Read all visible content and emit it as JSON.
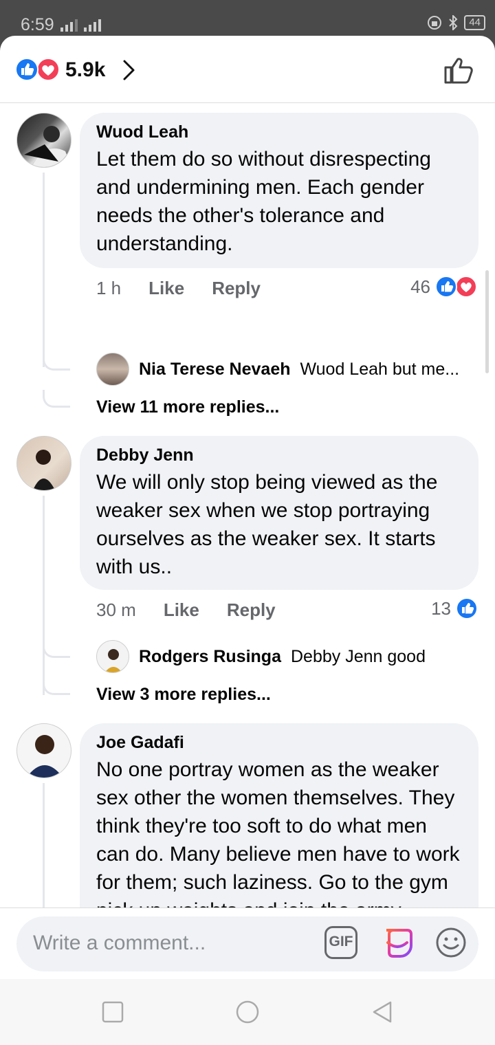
{
  "status_bar": {
    "time": "6:59",
    "battery": "44"
  },
  "header": {
    "reaction_count": "5.9k"
  },
  "comments": [
    {
      "author": "Wuod Leah",
      "text": "Let them do so without disrespecting and undermining men. Each gender needs the other's tolerance and understanding.",
      "time": "1 h",
      "like_label": "Like",
      "reply_label": "Reply",
      "reactions": "46",
      "reply_preview": {
        "author": "Nia Terese Nevaeh",
        "text": "Wuod Leah but me..."
      },
      "view_more": "View 11 more replies..."
    },
    {
      "author": "Debby Jenn",
      "text": "We will only stop being viewed as the weaker sex when we stop portraying ourselves as the weaker sex. It starts with us..",
      "time": "30 m",
      "like_label": "Like",
      "reply_label": "Reply",
      "reactions": "13",
      "reply_preview": {
        "author": "Rodgers Rusinga",
        "text": "Debby Jenn good"
      },
      "view_more": "View 3 more replies..."
    },
    {
      "author": "Joe Gadafi",
      "text": "No one portray women as the weaker sex other the women themselves. They think they're too soft to do what men can do. Many believe men have to work for them; such laziness. Go to the gym pick up weights and join the army. Tumbavu🙂"
    }
  ],
  "composer": {
    "placeholder": "Write a comment...",
    "gif_label": "GIF"
  },
  "icons": {
    "like_reaction": "like-reaction-icon",
    "love_reaction": "love-reaction-icon",
    "chevron": "chevron-right-icon",
    "thumbs_up": "thumbs-up-icon",
    "gif": "gif-icon",
    "sticker": "sticker-icon",
    "emoji": "emoji-icon"
  },
  "colors": {
    "like_blue": "#1877f2",
    "love_red": "#f33e58",
    "bubble_bg": "#f0f2f5",
    "meta_gray": "#65676b"
  }
}
